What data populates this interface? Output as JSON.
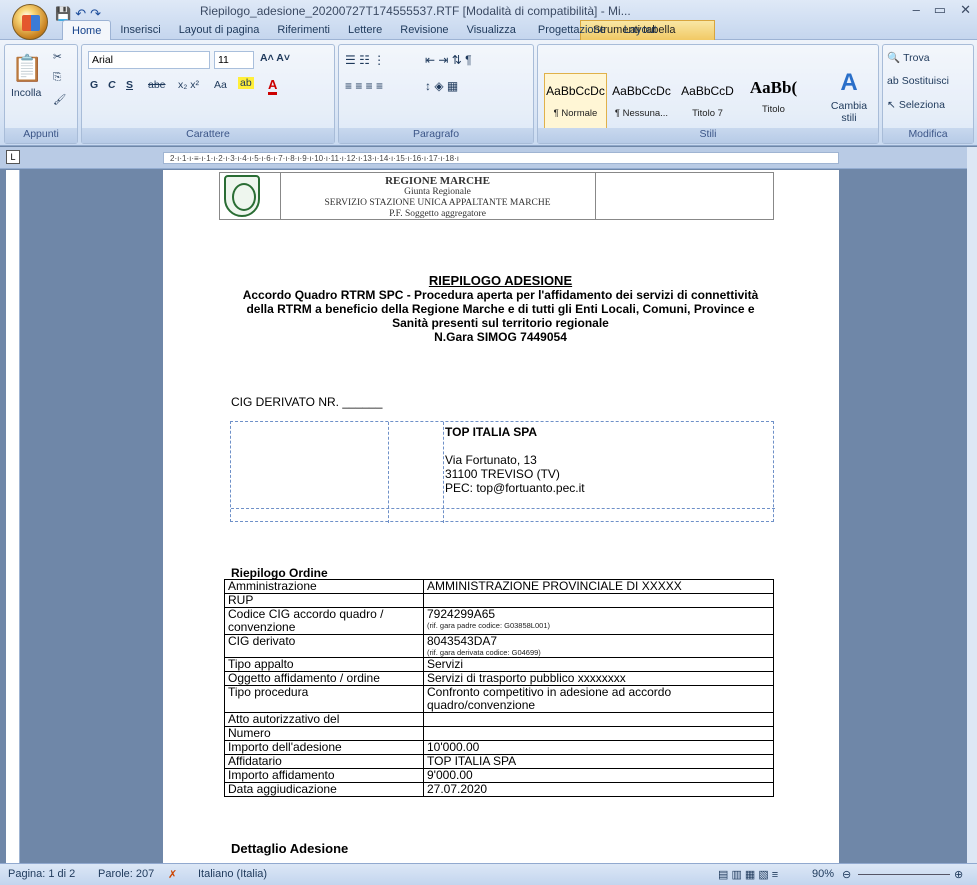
{
  "window": {
    "title": "Riepilogo_adesione_20200727T174555537.RTF [Modalità di compatibilità] - Mi...",
    "context_tab": "Strumenti tabella"
  },
  "tabs": [
    "Home",
    "Inserisci",
    "Layout di pagina",
    "Riferimenti",
    "Lettere",
    "Revisione",
    "Visualizza",
    "Progettazione",
    "Layout"
  ],
  "ribbon": {
    "clipboard": {
      "paste": "Incolla",
      "label": "Appunti"
    },
    "font": {
      "name": "Arial",
      "size": "11",
      "bold": "G",
      "italic": "C",
      "underline": "S",
      "strike": "abe",
      "label": "Carattere"
    },
    "paragraph": {
      "label": "Paragrafo"
    },
    "styles": {
      "label": "Stili",
      "items": [
        {
          "sample": "AaBbCcDc",
          "name": "¶ Normale"
        },
        {
          "sample": "AaBbCcDc",
          "name": "¶ Nessuna..."
        },
        {
          "sample": "AaBbCcD",
          "name": "Titolo 7"
        },
        {
          "sample": "AaBb(",
          "name": "Titolo"
        }
      ],
      "change": "Cambia stili"
    },
    "edit": {
      "find": "Trova",
      "replace": "Sostituisci",
      "select": "Seleziona",
      "label": "Modifica"
    }
  },
  "ruler_text": "2·ı·1·ı·≡·ı·1·ı·2·ı·3·ı·4·ı·5·ı·6·ı·7·ı·8·ı·9·ı·10·ı·11·ı·12·ı·13·ı·14·ı·15·ı·16·ı·17·ı·18·ı",
  "document": {
    "header": {
      "l1": "REGIONE MARCHE",
      "l2": "Giunta Regionale",
      "l3": "SERVIZIO STAZIONE UNICA APPALTANTE MARCHE",
      "l4": "P.F. Soggetto aggregatore"
    },
    "title": {
      "main": "RIEPILOGO ADESIONE",
      "l1": "Accordo Quadro RTRM SPC - Procedura aperta per l'affidamento dei servizi di connettività",
      "l2": "della RTRM a beneficio della Regione Marche e di tutti gli Enti Locali, Comuni, Province e",
      "l3": "Sanità presenti sul territorio regionale",
      "l4": "N.Gara SIMOG 7449054"
    },
    "cig_line": "CIG DERIVATO NR. ______",
    "address": {
      "company": "TOP ITALIA SPA",
      "street": "Via Fortunato, 13",
      "city": "31100 TREVISO (TV)",
      "pec": "PEC: top@fortuanto.pec.it"
    },
    "order_title": "Riepilogo Ordine",
    "order": [
      {
        "k": "Amministrazione",
        "v": "AMMINISTRAZIONE PROVINCIALE DI XXXXX",
        "s": ""
      },
      {
        "k": "RUP",
        "v": "",
        "s": ""
      },
      {
        "k": "Codice CIG accordo quadro / convenzione",
        "v": "7924299A65",
        "s": "(rif. gara padre codice: G03858L001)"
      },
      {
        "k": "CIG derivato",
        "v": "8043543DA7",
        "s": "(rif. gara derivata codice: G04699)"
      },
      {
        "k": "Tipo appalto",
        "v": "Servizi",
        "s": ""
      },
      {
        "k": "Oggetto affidamento / ordine",
        "v": "Servizi di trasporto pubblico xxxxxxxx",
        "s": ""
      },
      {
        "k": "Tipo procedura",
        "v": "Confronto competitivo in adesione ad accordo quadro/convenzione",
        "s": ""
      },
      {
        "k": "Atto autorizzativo del",
        "v": "",
        "s": ""
      },
      {
        "k": "Numero",
        "v": "",
        "s": ""
      },
      {
        "k": "Importo dell'adesione",
        "v": "10'000.00",
        "s": ""
      },
      {
        "k": "Affidatario",
        "v": "TOP ITALIA SPA",
        "s": ""
      },
      {
        "k": "Importo affidamento",
        "v": "9'000.00",
        "s": ""
      },
      {
        "k": "Data aggiudicazione",
        "v": "27.07.2020",
        "s": ""
      }
    ],
    "detail_title": "Dettaglio Adesione"
  },
  "status": {
    "page": "Pagina: 1 di 2",
    "words": "Parole: 207",
    "lang": "Italiano (Italia)",
    "zoom": "90%"
  }
}
